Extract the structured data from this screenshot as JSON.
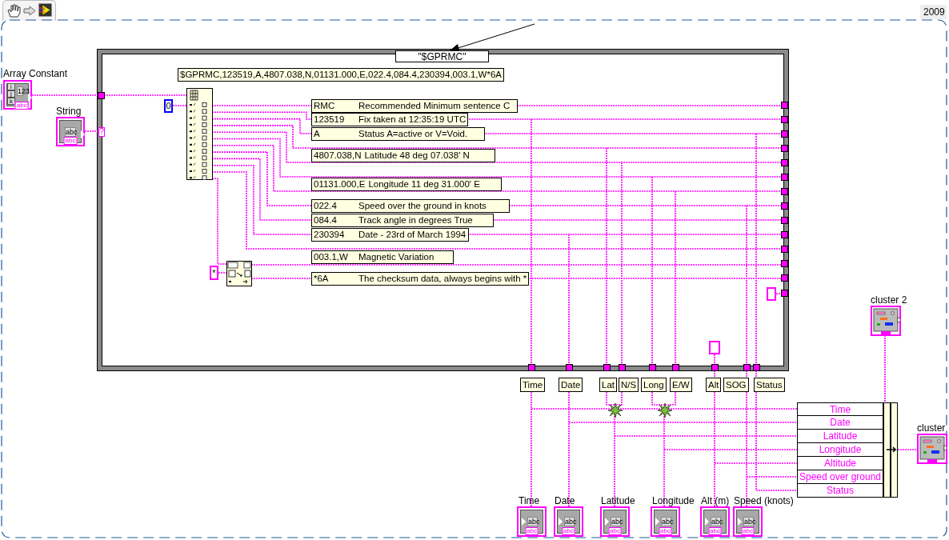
{
  "year_label": "2009",
  "case_selector": "\"$GPRMC\"",
  "sample_sentence": "$GPRMC,123519,A,4807.038,N,01131.000,E,022.4,084.4,230394,003.1,W*6A",
  "index_constant": "0",
  "delimiter_constant": "*",
  "inputs": [
    {
      "kind": "array",
      "label": "Array Constant",
      "display": "123",
      "indexes": [
        "i",
        "j",
        "k"
      ],
      "type_tag": "abc"
    },
    {
      "kind": "string",
      "label": "String",
      "display": "abc",
      "type_tag": "abc"
    }
  ],
  "unwired_tunnel": "?",
  "field_comments": [
    {
      "value": "RMC",
      "description": "Recommended Minimum sentence C"
    },
    {
      "value": "123519",
      "description": "Fix taken at 12:35:19 UTC"
    },
    {
      "value": "A",
      "description": "Status A=active or V=Void."
    },
    {
      "value": "4807.038,N",
      "description": "Latitude 48 deg 07.038' N"
    },
    {
      "value": "01131.000,E",
      "description": "Longitude 11 deg 31.000' E"
    },
    {
      "value": "022.4",
      "description": "Speed over the ground in knots"
    },
    {
      "value": "084.4",
      "description": "Track angle in degrees True"
    },
    {
      "value": "230394",
      "description": "Date - 23rd of March 1994"
    },
    {
      "value": "003.1,W",
      "description": "Magnetic Variation"
    },
    {
      "value": "*6A",
      "description": "The checksum data, always begins with *"
    }
  ],
  "tunnel_labels": [
    "Time",
    "Date",
    "Lat",
    "N/S",
    "Long",
    "E/W",
    "Alt",
    "SOG",
    "Status"
  ],
  "bundle_elements": [
    "Time",
    "Date",
    "Latitude",
    "Longitude",
    "Altitude",
    "Speed over ground",
    "Status"
  ],
  "clusters": [
    {
      "label": "cluster 2"
    },
    {
      "label": "cluster"
    }
  ],
  "indicators": [
    {
      "label": "Time",
      "display": "abc",
      "type_tag": "abc"
    },
    {
      "label": "Date",
      "display": "abc",
      "type_tag": "abc"
    },
    {
      "label": "Latitude",
      "display": "abc",
      "type_tag": "abc"
    },
    {
      "label": "Longitude",
      "display": "abc",
      "type_tag": "abc"
    },
    {
      "label": "Alt (m)",
      "display": "abc",
      "type_tag": "abc"
    },
    {
      "label": "Speed (knots)",
      "display": "abc",
      "type_tag": "abc"
    }
  ]
}
